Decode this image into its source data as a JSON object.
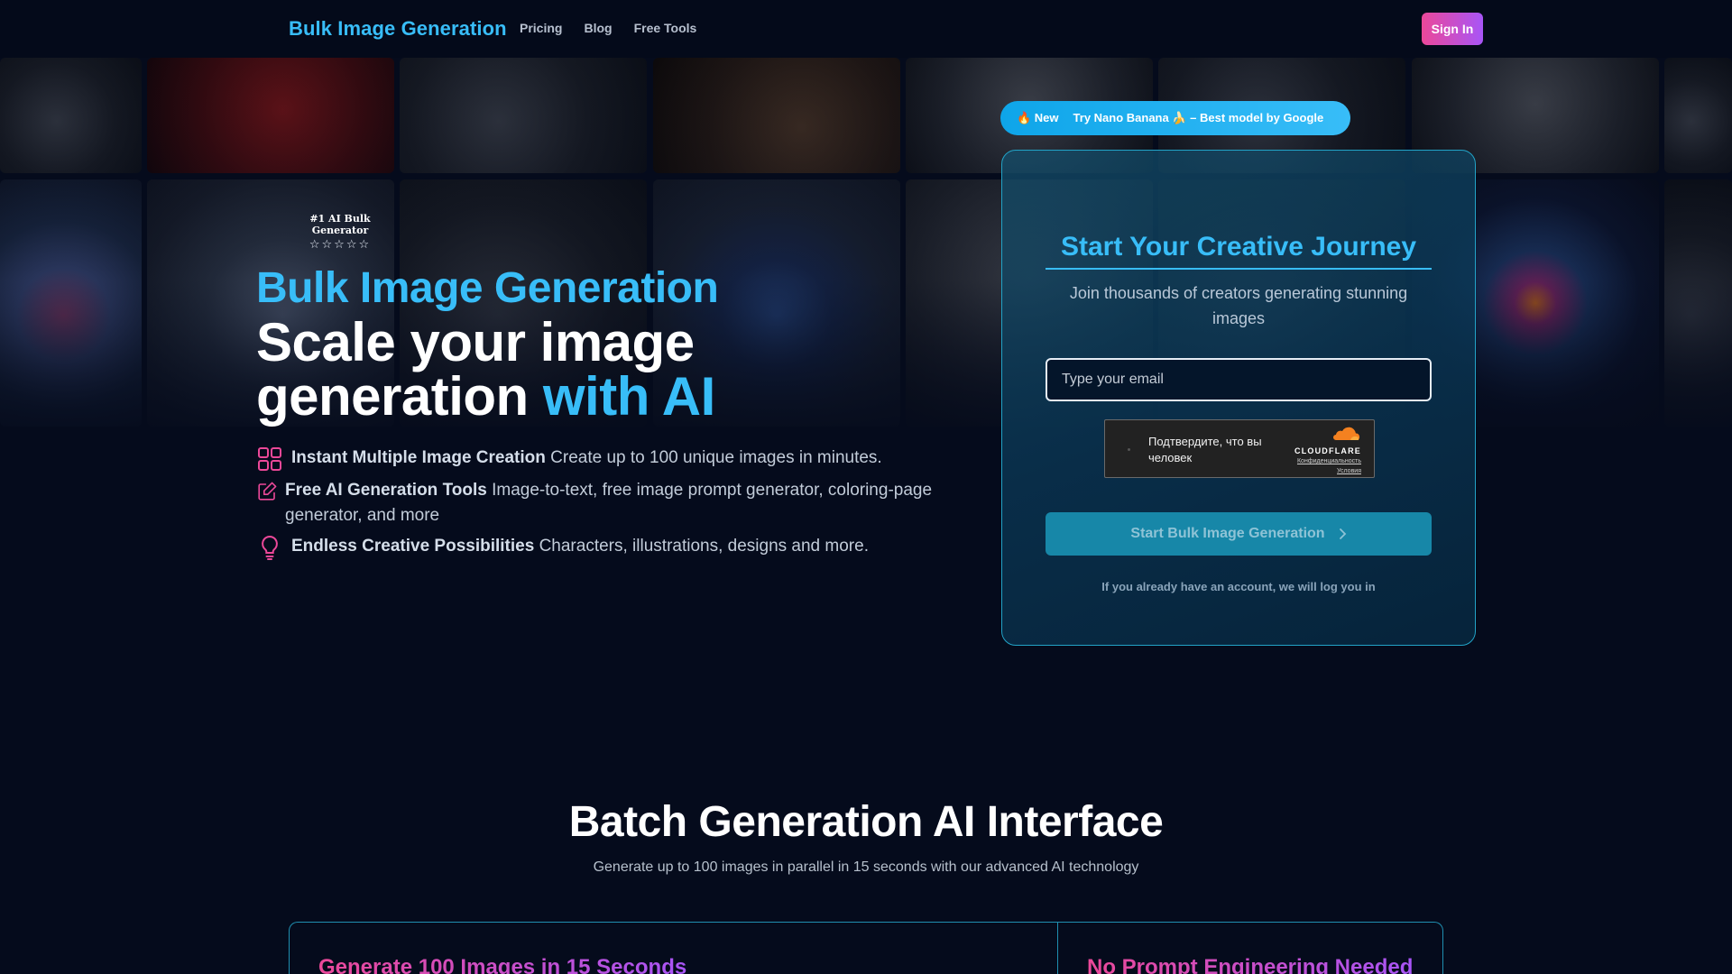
{
  "navbar": {
    "brand": "Bulk Image Generation",
    "links": [
      "Pricing",
      "Blog",
      "Free Tools"
    ],
    "sign_in": "Sign In"
  },
  "hero": {
    "badge": "#1 AI Bulk Generator",
    "stars": "☆☆☆☆☆",
    "kicker": "Bulk Image Generation",
    "title_main": "Scale your image generation",
    "title_accent": "with AI",
    "features": [
      {
        "icon": "grid-icon",
        "title": "Instant Multiple Image Creation",
        "desc": "Create up to 100 unique images in minutes."
      },
      {
        "icon": "edit-icon",
        "title": "Free AI Generation Tools",
        "desc": "Image-to-text, free image prompt generator, coloring-page generator, and more"
      },
      {
        "icon": "lightbulb-icon",
        "title": "Endless Creative Possibilities",
        "desc": "Characters, illustrations, designs and more."
      }
    ]
  },
  "promo": {
    "tag": "🔥 New",
    "text": "Try Nano Banana 🍌 – Best model by Google"
  },
  "signup": {
    "title": "Start Your Creative Journey",
    "subtitle": "Join thousands of creators generating stunning images",
    "email_placeholder": "Type your email",
    "captcha_text": "Подтвердите, что вы человек",
    "captcha_brand": "CLOUDFLARE",
    "captcha_privacy": "Конфиденциальность",
    "captcha_terms": "Условия",
    "cta": "Start Bulk Image Generation",
    "note": "If you already have an account, we will log you in"
  },
  "section": {
    "title": "Batch Generation AI Interface",
    "subtitle": "Generate up to 100 images in parallel in 15 seconds with our advanced AI technology",
    "panel_left": "Generate 100 Images in 15 Seconds",
    "panel_right": "No Prompt Engineering Needed"
  },
  "colors": {
    "accent": "#38bdf8",
    "background": "#050b1c",
    "gradient_pink": "#ec4899",
    "gradient_purple": "#a855f7"
  }
}
